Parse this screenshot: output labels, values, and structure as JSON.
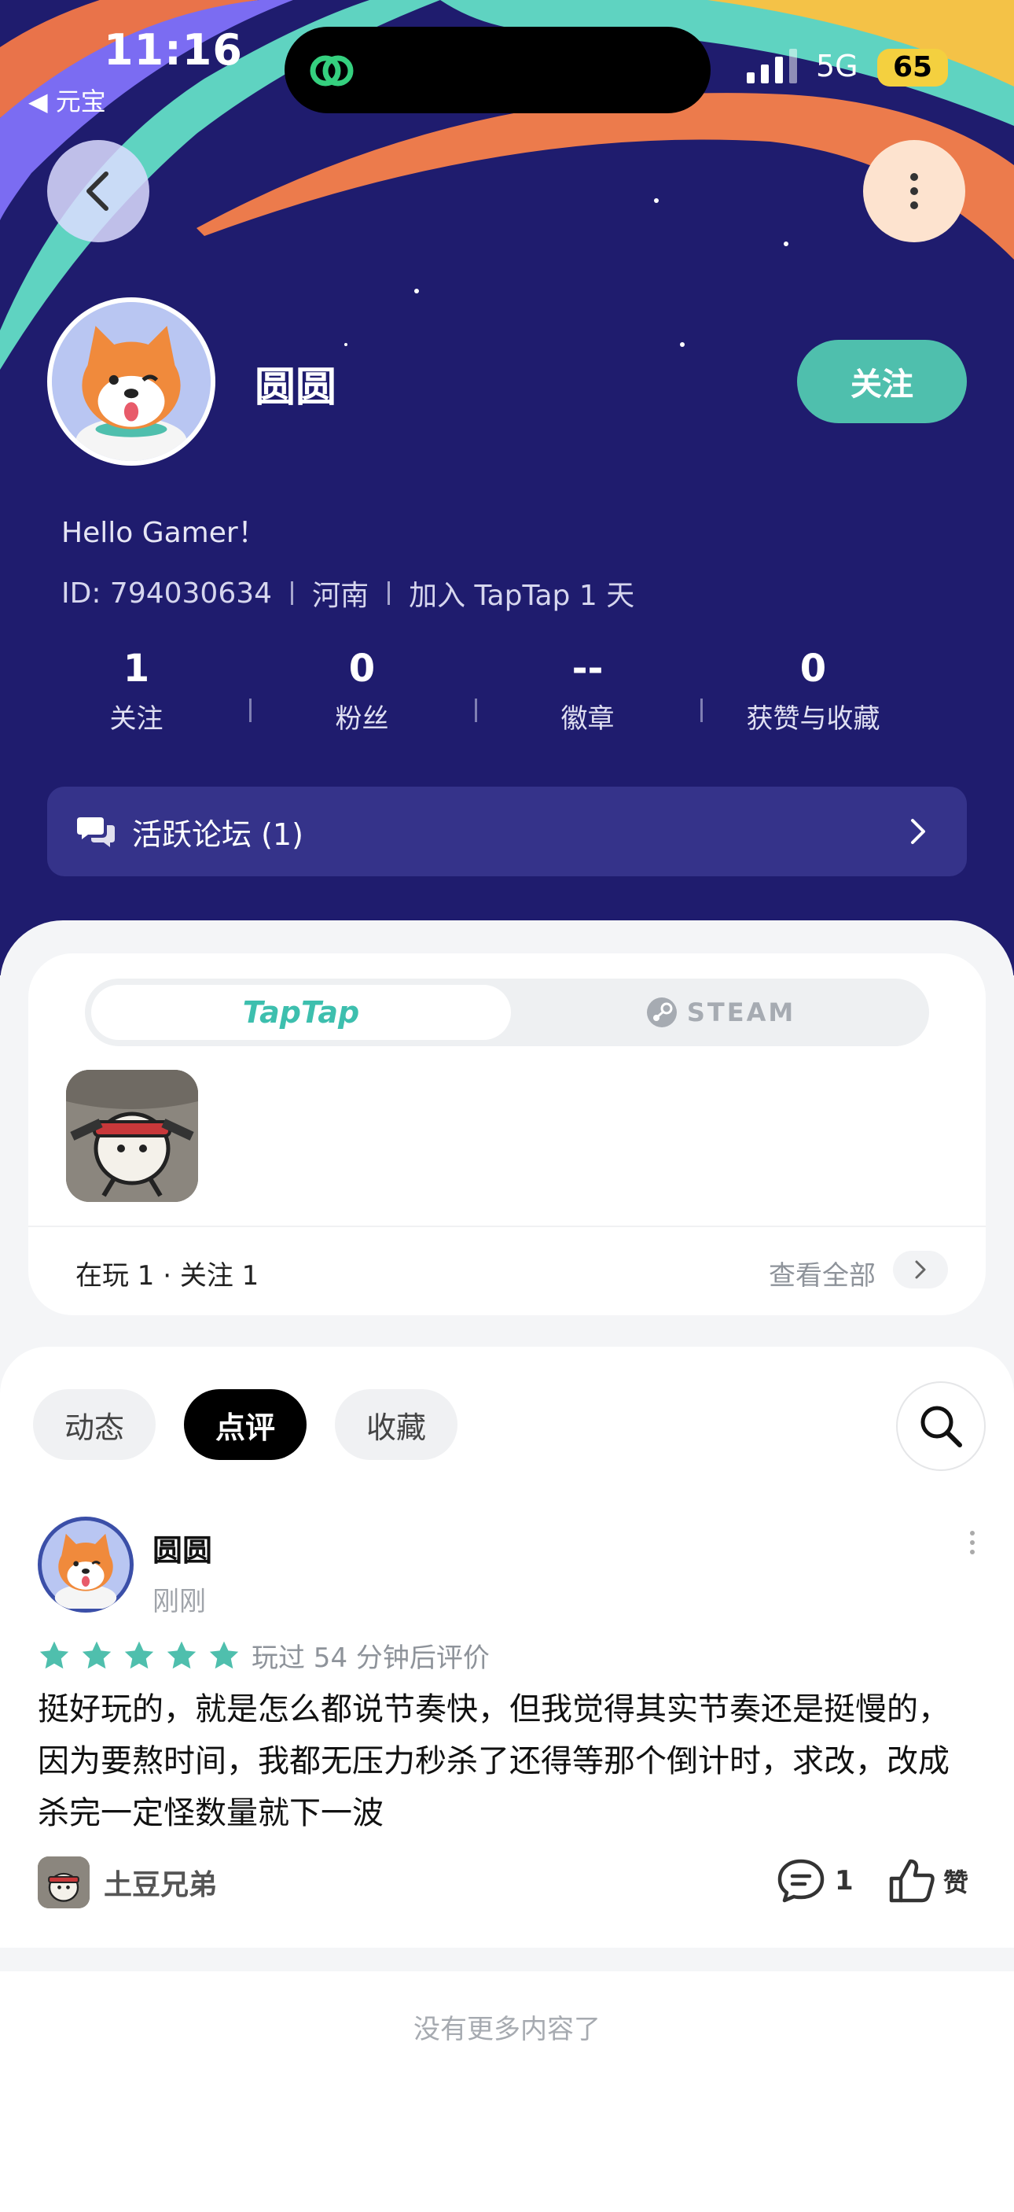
{
  "status_bar": {
    "time": "11:16",
    "back_app": "元宝",
    "network": "5G",
    "battery": "65"
  },
  "profile": {
    "name": "圆圆",
    "follow_label": "关注",
    "bio": "Hello Gamer！",
    "id_text": "ID: 794030634",
    "region": "河南",
    "joined": "加入 TapTap 1 天",
    "stats": [
      {
        "value": "1",
        "label": "关注"
      },
      {
        "value": "0",
        "label": "粉丝"
      },
      {
        "value": "--",
        "label": "徽章"
      },
      {
        "value": "0",
        "label": "获赞与收藏"
      }
    ],
    "forum_label": "活跃论坛 (1)"
  },
  "games_card": {
    "tabs": [
      "TapTap",
      "STEAM"
    ],
    "active_tab": "TapTap",
    "summary": "在玩 1 · 关注 1",
    "view_all": "查看全部"
  },
  "feed": {
    "tabs": [
      "动态",
      "点评",
      "收藏"
    ],
    "active_tab": "点评",
    "post": {
      "author": "圆圆",
      "time": "刚刚",
      "rating": 5,
      "play_time": "玩过 54 分钟后评价",
      "body": "挺好玩的，就是怎么都说节奏快，但我觉得其实节奏还是挺慢的，因为要熬时间，我都无压力秒杀了还得等那个倒计时，求改，改成杀完一定怪数量就下一波",
      "game_name": "土豆兄弟",
      "comments": "1",
      "like_label": "赞"
    },
    "end_text": "没有更多内容了"
  },
  "colors": {
    "header_bg": "#1f1c6e",
    "accent_green": "#4fbfad",
    "star": "#4fbfad",
    "forum_bg": "#35338a"
  }
}
